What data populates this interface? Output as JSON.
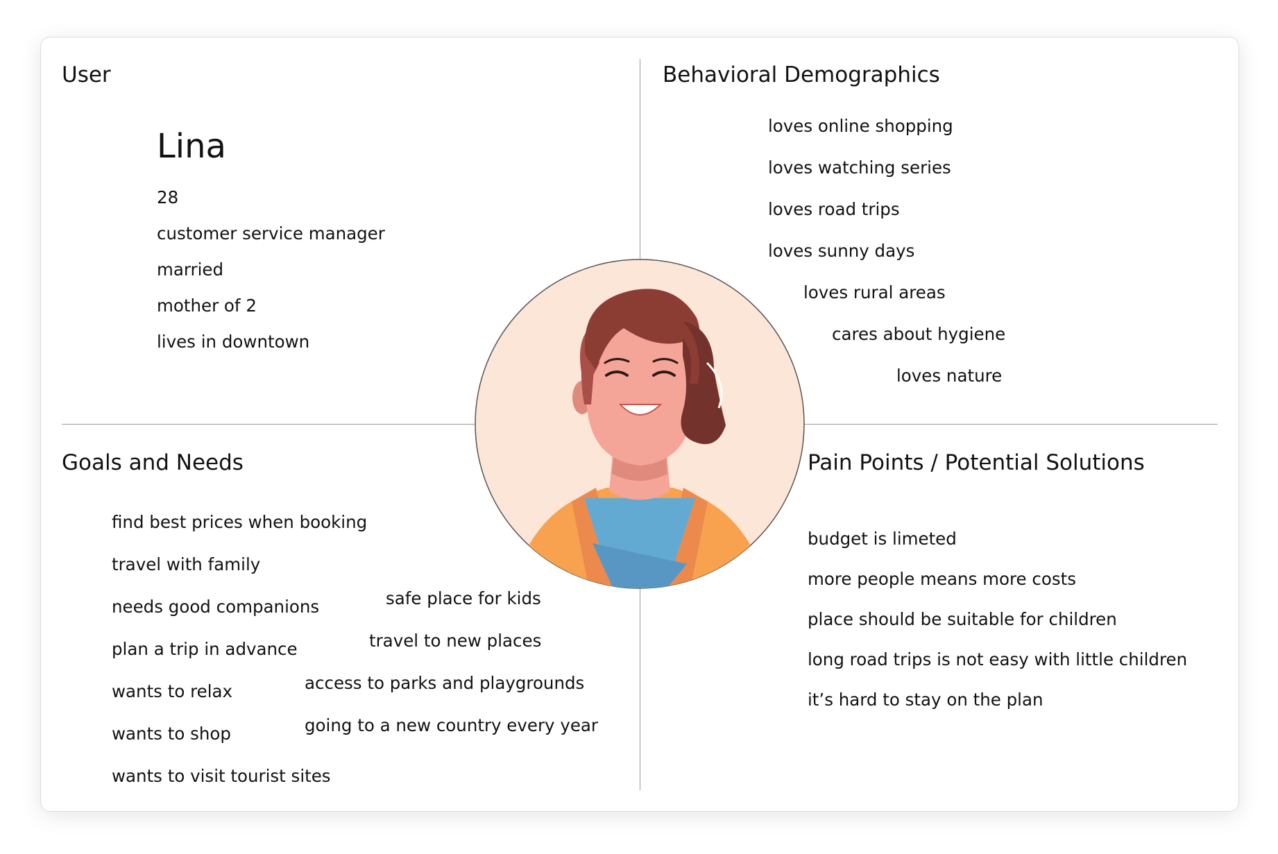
{
  "user": {
    "heading": "User",
    "name": "Lina",
    "details": [
      "28",
      "customer service manager",
      "married",
      "mother of 2",
      "lives in downtown"
    ]
  },
  "behavioral": {
    "heading": "Behavioral Demographics",
    "items": [
      "loves online shopping",
      "loves watching series",
      "loves road trips",
      "loves sunny days",
      "loves rural areas",
      "cares about hygiene",
      "loves nature"
    ]
  },
  "goals": {
    "heading": "Goals and Needs",
    "left_items": [
      "find best prices when booking",
      "travel with family",
      "needs good companions",
      "plan a trip in advance",
      "wants to relax",
      "wants to shop",
      "wants to visit tourist sites"
    ],
    "right_items": [
      "safe place for kids",
      "travel to new places",
      "access to parks and playgrounds",
      "going to a new country every year"
    ]
  },
  "pain_points": {
    "heading": "Pain Points / Potential Solutions",
    "items": [
      "budget is limeted",
      "more people means more costs",
      "place should be suitable for children",
      "long road trips is not easy with little children",
      "it’s hard to stay on the plan"
    ]
  },
  "avatar": {
    "icon": "woman-avatar-icon"
  },
  "colors": {
    "avatar_background": "#fce6d7",
    "hair": "#8b3d34",
    "skin": "#f5a597",
    "shirt": "#63aad3",
    "jacket": "#f8a24f"
  }
}
